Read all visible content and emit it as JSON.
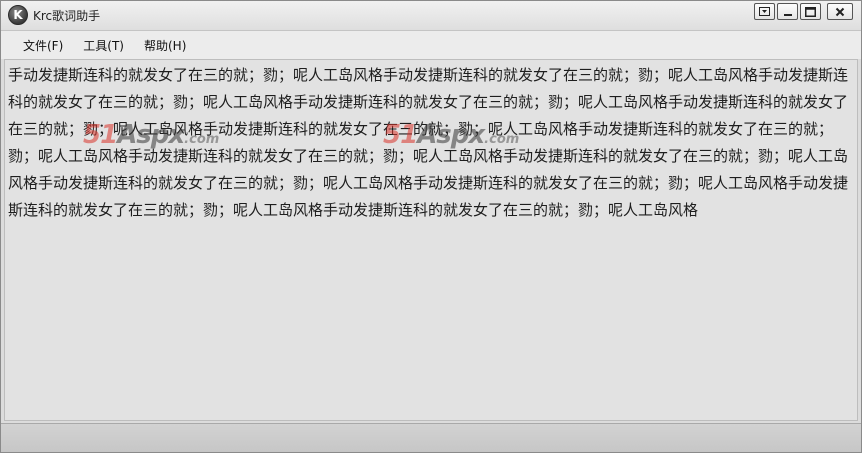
{
  "window": {
    "title": "Krc歌词助手",
    "icon_letter": "K"
  },
  "titlebar_buttons": [
    {
      "name": "menu-dropdown-button",
      "icon": "dropdown-box-icon"
    },
    {
      "name": "minimize-button",
      "icon": "minimize-icon"
    },
    {
      "name": "maximize-button",
      "icon": "maximize-icon"
    },
    {
      "name": "close-button",
      "icon": "close-icon"
    }
  ],
  "menubar": {
    "file": "文件(F)",
    "tools": "工具(T)",
    "help": "帮助(H)"
  },
  "content": {
    "lyrics": "手动发捷斯连科的就发女了在三的就；勠；呢人工岛风格手动发捷斯连科的就发女了在三的就；勠；呢人工岛风格手动发捷斯连科的就发女了在三的就；勠；呢人工岛风格手动发捷斯连科的就发女了在三的就；勠；呢人工岛风格手动发捷斯连科的就发女了在三的就；勠；呢人工岛风格手动发捷斯连科的就发女了在三的就；勠；呢人工岛风格手动发捷斯连科的就发女了在三的就；勠；呢人工岛风格手动发捷斯连科的就发女了在三的就；勠；呢人工岛风格手动发捷斯连科的就发女了在三的就；勠；呢人工岛风格手动发捷斯连科的就发女了在三的就；勠；呢人工岛风格手动发捷斯连科的就发女了在三的就；勠；呢人工岛风格手动发捷斯连科的就发女了在三的就；勠；呢人工岛风格手动发捷斯连科的就发女了在三的就；勠；呢人工岛风格"
  },
  "watermark": {
    "number": "51",
    "text": "Aspx",
    "suffix": ".com"
  },
  "colors": {
    "watermark_number": "#d9342b",
    "content_bg": "#e2e2e2"
  }
}
